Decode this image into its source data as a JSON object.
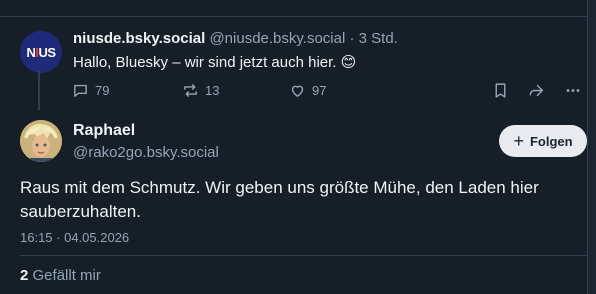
{
  "post": {
    "author_name": "niusde.bsky.social",
    "author_handle": "@niusde.bsky.social",
    "separator": "·",
    "time": "3 Std.",
    "text": "Hallo, Bluesky – wir sind jetzt auch hier. 😊",
    "avatar_text_n": "N",
    "avatar_text_i": "I",
    "avatar_text_us": "US",
    "replies": "79",
    "reposts": "13",
    "likes": "97"
  },
  "reply": {
    "author_name": "Raphael",
    "author_handle": "@rako2go.bsky.social",
    "follow_label": "Folgen",
    "text": "Raus mit dem Schmutz. Wir geben uns größte Mühe, den Laden hier sauberzuhalten.",
    "timestamp": "16:15 · 04.05.2026",
    "like_count": "2",
    "like_label": "Gefällt mir"
  },
  "icons": {
    "reply": "speech-bubble-icon",
    "repost": "repost-icon",
    "like": "heart-icon",
    "bookmark": "bookmark-icon",
    "share": "share-arrow-icon",
    "more": "more-dots-icon",
    "follow": "plus-icon"
  },
  "colors": {
    "background": "#161e27",
    "muted_text": "#93a5b7",
    "follow_button": "#e8ecf0"
  }
}
